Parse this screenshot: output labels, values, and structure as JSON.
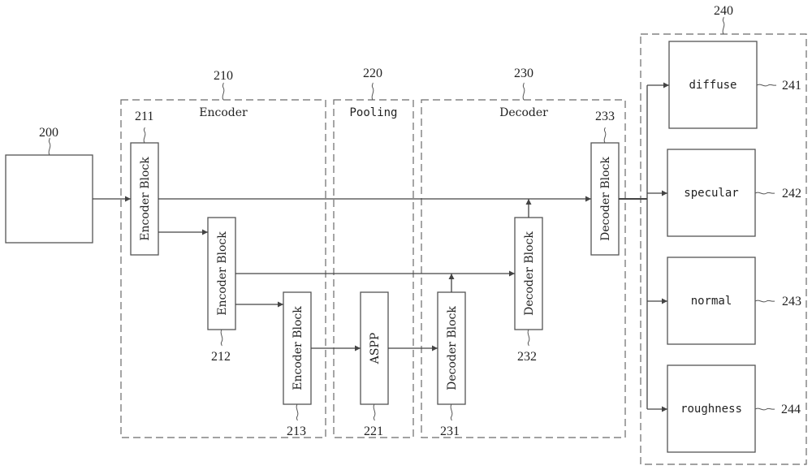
{
  "diagram": {
    "input": {
      "ref": "200",
      "label": ""
    },
    "encoder": {
      "ref": "210",
      "title": "Encoder",
      "blocks": [
        {
          "ref": "211",
          "label": "Encoder Block"
        },
        {
          "ref": "212",
          "label": "Encoder Block"
        },
        {
          "ref": "213",
          "label": "Encoder Block"
        }
      ]
    },
    "pooling": {
      "ref": "220",
      "title": "Pooling",
      "blocks": [
        {
          "ref": "221",
          "label": "ASPP"
        }
      ]
    },
    "decoder": {
      "ref": "230",
      "title": "Decoder",
      "blocks": [
        {
          "ref": "231",
          "label": "Decoder Block"
        },
        {
          "ref": "232",
          "label": "Decoder Block"
        },
        {
          "ref": "233",
          "label": "Decoder Block"
        }
      ]
    },
    "outputs": {
      "ref": "240",
      "items": [
        {
          "ref": "241",
          "label": "diffuse"
        },
        {
          "ref": "242",
          "label": "specular"
        },
        {
          "ref": "243",
          "label": "normal"
        },
        {
          "ref": "244",
          "label": "roughness"
        }
      ]
    },
    "connections": [
      {
        "from": "200",
        "to": "211"
      },
      {
        "from": "211",
        "to": "212"
      },
      {
        "from": "212",
        "to": "213"
      },
      {
        "from": "213",
        "to": "221"
      },
      {
        "from": "221",
        "to": "231"
      },
      {
        "from": "231",
        "to": "232"
      },
      {
        "from": "212",
        "to": "232",
        "type": "skip"
      },
      {
        "from": "232",
        "to": "233"
      },
      {
        "from": "211",
        "to": "233",
        "type": "skip"
      },
      {
        "from": "233",
        "to": "241"
      },
      {
        "from": "233",
        "to": "242"
      },
      {
        "from": "233",
        "to": "243"
      },
      {
        "from": "233",
        "to": "244"
      }
    ]
  }
}
